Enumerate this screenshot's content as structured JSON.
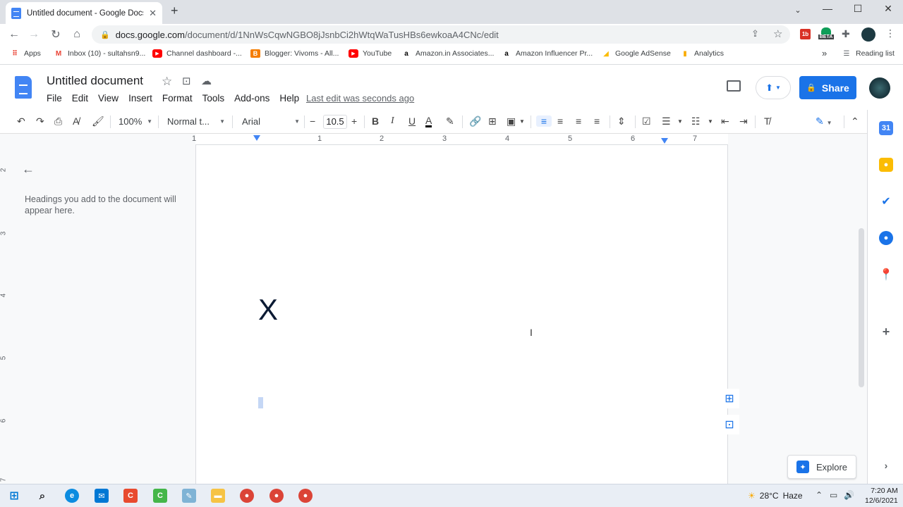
{
  "browser": {
    "tab_title": "Untitled document - Google Docs",
    "url_host": "docs.google.com",
    "url_path": "/document/d/1NnWsCqwNGBO8jJsnbCi2hWtqWaTusHBs6ewkoaA4CNc/edit",
    "bookmarks": [
      {
        "label": "Apps",
        "icon": "apps-grid-icon",
        "color": "#ea4335"
      },
      {
        "label": "Inbox (10) - sultahsn9...",
        "icon": "gmail-icon",
        "color": "#ea4335"
      },
      {
        "label": "Channel dashboard -...",
        "icon": "youtube-icon",
        "color": "#ff0000"
      },
      {
        "label": "Blogger: Vivoms - All...",
        "icon": "blogger-icon",
        "color": "#f57d00"
      },
      {
        "label": "YouTube",
        "icon": "youtube-icon",
        "color": "#ff0000"
      },
      {
        "label": "Amazon.in Associates...",
        "icon": "amazon-icon",
        "color": "#000000"
      },
      {
        "label": "Amazon Influencer Pr...",
        "icon": "amazon-icon",
        "color": "#000000"
      },
      {
        "label": "Google AdSense",
        "icon": "adsense-icon",
        "color": "#fbbc04"
      },
      {
        "label": "Analytics",
        "icon": "analytics-icon",
        "color": "#f9ab00"
      }
    ],
    "more_bookmarks": "»",
    "reading_list": "Reading list",
    "extension_beta": "BETA"
  },
  "docs": {
    "title": "Untitled document",
    "menu": [
      "File",
      "Edit",
      "View",
      "Insert",
      "Format",
      "Tools",
      "Add-ons",
      "Help"
    ],
    "last_edit": "Last edit was seconds ago",
    "share_label": "Share",
    "toolbar": {
      "zoom": "100%",
      "style": "Normal t...",
      "font": "Arial",
      "font_size": "10.5"
    },
    "ruler_numbers": [
      "1",
      "1",
      "2",
      "3",
      "4",
      "5",
      "6",
      "7"
    ],
    "vertical_ruler_numbers": [
      "2",
      "3",
      "4",
      "5",
      "6",
      "7"
    ],
    "outline_hint": "Headings you add to the document will appear here.",
    "body_text": "X",
    "explore_label": "Explore"
  },
  "taskbar": {
    "weather_temp": "28°C",
    "weather_desc": "Haze",
    "time": "7:20 AM",
    "date": "12/6/2021"
  },
  "colors": {
    "accent": "#1a73e8",
    "tabstrip": "#dee1e6"
  }
}
